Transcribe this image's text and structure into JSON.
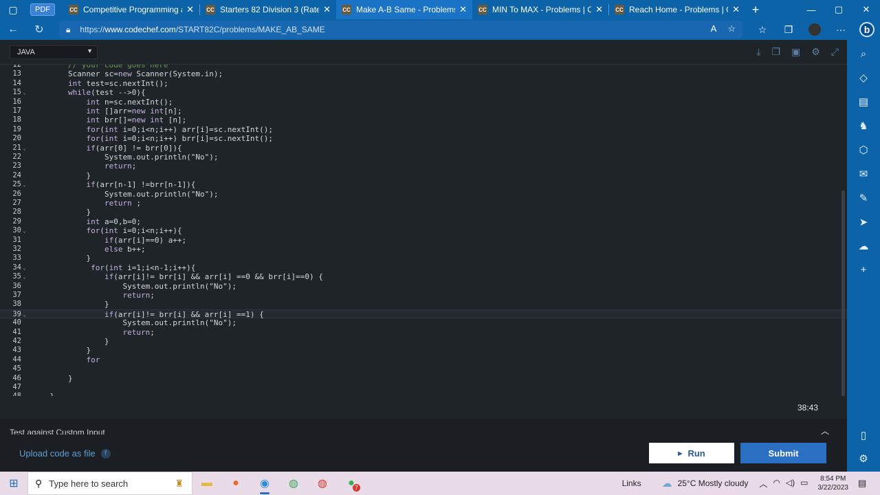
{
  "browser": {
    "pdf_label": "PDF",
    "tabs": [
      {
        "title": "Competitive Programming and C",
        "favicon": "CC",
        "active": false
      },
      {
        "title": "Starters 82 Division 3 (Rated) Co",
        "favicon": "CC",
        "active": false
      },
      {
        "title": "Make A-B Same - Problems | Co",
        "favicon": "CC",
        "active": true
      },
      {
        "title": "MIN To MAX - Problems | CodeC",
        "favicon": "CC",
        "active": false
      },
      {
        "title": "Reach Home - Problems | CodeC",
        "favicon": "CC",
        "active": false
      }
    ],
    "url_prefix": "https://",
    "url_domain": "www.codechef.com",
    "url_path": "/START82C/problems/MAKE_AB_SAME"
  },
  "editor": {
    "language": "JAVA",
    "current_line": 39,
    "lines": [
      {
        "n": "12",
        "text": "        // your code goes here",
        "fold": false
      },
      {
        "n": "13",
        "text": "        Scanner sc=new Scanner(System.in);",
        "fold": false
      },
      {
        "n": "14",
        "text": "        int test=sc.nextInt();",
        "fold": false
      },
      {
        "n": "15",
        "text": "        while(test -->0){",
        "fold": true
      },
      {
        "n": "16",
        "text": "            int n=sc.nextInt();",
        "fold": false
      },
      {
        "n": "17",
        "text": "            int []arr=new int[n];",
        "fold": false
      },
      {
        "n": "18",
        "text": "            int brr[]=new int [n];",
        "fold": false
      },
      {
        "n": "19",
        "text": "            for(int i=0;i<n;i++) arr[i]=sc.nextInt();",
        "fold": false
      },
      {
        "n": "20",
        "text": "            for(int i=0;i<n;i++) brr[i]=sc.nextInt();",
        "fold": false
      },
      {
        "n": "21",
        "text": "            if(arr[0] != brr[0]){",
        "fold": true
      },
      {
        "n": "22",
        "text": "                System.out.println(\"No\");",
        "fold": false
      },
      {
        "n": "23",
        "text": "                return;",
        "fold": false
      },
      {
        "n": "24",
        "text": "            }",
        "fold": false
      },
      {
        "n": "25",
        "text": "            if(arr[n-1] !=brr[n-1]){",
        "fold": true
      },
      {
        "n": "26",
        "text": "                System.out.println(\"No\");",
        "fold": false
      },
      {
        "n": "27",
        "text": "                return ;",
        "fold": false
      },
      {
        "n": "28",
        "text": "            }",
        "fold": false
      },
      {
        "n": "29",
        "text": "            int a=0,b=0;",
        "fold": false
      },
      {
        "n": "30",
        "text": "            for(int i=0;i<n;i++){",
        "fold": true
      },
      {
        "n": "31",
        "text": "                if(arr[i]==0) a++;",
        "fold": false
      },
      {
        "n": "32",
        "text": "                else b++;",
        "fold": false
      },
      {
        "n": "33",
        "text": "            }",
        "fold": false
      },
      {
        "n": "34",
        "text": "             for(int i=1;i<n-1;i++){",
        "fold": true
      },
      {
        "n": "35",
        "text": "                if(arr[i]!= brr[i] && arr[i] ==0 && brr[i]==0) {",
        "fold": true
      },
      {
        "n": "36",
        "text": "                    System.out.println(\"No\");",
        "fold": false
      },
      {
        "n": "37",
        "text": "                    return;",
        "fold": false
      },
      {
        "n": "38",
        "text": "                }",
        "fold": false
      },
      {
        "n": "39",
        "text": "                if(arr[i]!= brr[i] && arr[i] ==1) {",
        "fold": true
      },
      {
        "n": "40",
        "text": "                    System.out.println(\"No\");",
        "fold": false
      },
      {
        "n": "41",
        "text": "                    return;",
        "fold": false
      },
      {
        "n": "42",
        "text": "                }",
        "fold": false
      },
      {
        "n": "43",
        "text": "            }",
        "fold": false
      },
      {
        "n": "44",
        "text": "            for",
        "fold": false
      },
      {
        "n": "45",
        "text": "",
        "fold": false
      },
      {
        "n": "46",
        "text": "        }",
        "fold": false
      },
      {
        "n": "47",
        "text": "",
        "fold": false
      },
      {
        "n": "48",
        "text": "    }",
        "fold": false
      }
    ]
  },
  "timer": "38:43",
  "custom_input_label": "Test against Custom Input",
  "upload_label": "Upload code as file",
  "run_label": "Run",
  "submit_label": "Submit",
  "taskbar": {
    "search_placeholder": "Type here to search",
    "links_label": "Links",
    "weather": "25°C  Mostly cloudy",
    "time": "8:54 PM",
    "date": "3/22/2023",
    "chrome_badge": "7"
  },
  "colors": {
    "accent": "#2a6fc2",
    "browser_chrome": "#0c63a8",
    "editor_bg": "#1f2428"
  }
}
